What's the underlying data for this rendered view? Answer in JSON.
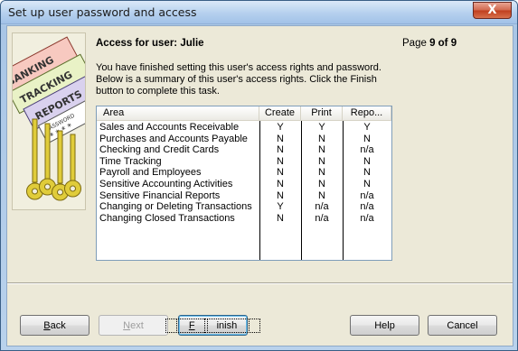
{
  "window": {
    "title": "Set up user password and access",
    "close_label": "X"
  },
  "illustration": {
    "labels": [
      "BANKING",
      "TRACKING",
      "REPORTS",
      "PASSWORD",
      "* * * *"
    ]
  },
  "heading": {
    "access_prefix": "Access for user: ",
    "user_name": "Julie",
    "page_label": "Page",
    "page_value": "9 of 9"
  },
  "description": {
    "line1": "You have finished setting this user's access rights and password.",
    "line2": "Below is a summary of this user's access rights.  Click the Finish",
    "line3": "button to complete this task."
  },
  "table": {
    "headers": {
      "area": "Area",
      "create": "Create",
      "print": "Print",
      "reports": "Repo..."
    },
    "rows": [
      {
        "area": "Sales and Accounts Receivable",
        "create": "Y",
        "print": "Y",
        "reports": "Y"
      },
      {
        "area": "Purchases and Accounts Payable",
        "create": "N",
        "print": "N",
        "reports": "N"
      },
      {
        "area": "Checking and Credit Cards",
        "create": "N",
        "print": "N",
        "reports": "n/a"
      },
      {
        "area": "Time Tracking",
        "create": "N",
        "print": "N",
        "reports": "N"
      },
      {
        "area": "Payroll and Employees",
        "create": "N",
        "print": "N",
        "reports": "N"
      },
      {
        "area": "Sensitive Accounting Activities",
        "create": "N",
        "print": "N",
        "reports": "N"
      },
      {
        "area": "Sensitive Financial Reports",
        "create": "N",
        "print": "N",
        "reports": "n/a"
      },
      {
        "area": "Changing or Deleting Transactions",
        "create": "Y",
        "print": "n/a",
        "reports": "n/a"
      },
      {
        "area": "Changing Closed Transactions",
        "create": "N",
        "print": "n/a",
        "reports": "n/a"
      }
    ]
  },
  "buttons": {
    "back": {
      "first": "B",
      "rest": "ack"
    },
    "next": {
      "first": "N",
      "rest": "ext"
    },
    "finish": {
      "first": "F",
      "rest": "inish"
    },
    "help": "Help",
    "cancel": "Cancel"
  }
}
